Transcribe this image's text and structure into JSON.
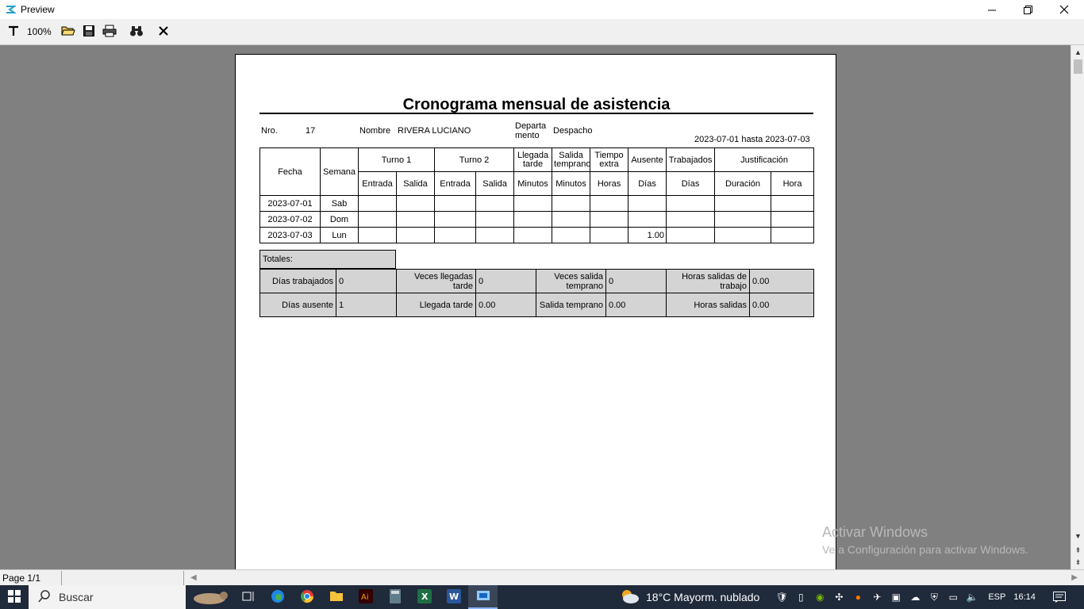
{
  "window": {
    "title": "Preview",
    "minimize": "—",
    "restore": "❐",
    "close": "✕"
  },
  "toolbar": {
    "zoom": "100%"
  },
  "report": {
    "title": "Cronograma mensual de asistencia",
    "nro_label": "Nro.",
    "nro_value": "17",
    "nombre_label": "Nombre",
    "nombre_value": "RIVERA LUCIANO",
    "depto_label_1": "Departa",
    "depto_label_2": "mento",
    "depto_value": "Despacho",
    "range": "2023-07-01 hasta 2023-07-03",
    "head1": {
      "fecha": "Fecha",
      "semana": "Semana",
      "turno1": "Turno 1",
      "turno2": "Turno 2",
      "llegada": "Llegada tarde",
      "salida_temp": "Salida temprano",
      "tiempo_extra": "Tiempo extra",
      "ausente": "Ausente",
      "trabajados": "Trabajados",
      "justificacion": "Justificación"
    },
    "head2": {
      "entrada1": "Entrada",
      "salida1": "Salida",
      "entrada2": "Entrada",
      "salida2": "Salida",
      "min1": "Minutos",
      "min2": "Minutos",
      "horas": "Horas",
      "dias1": "Días",
      "dias2": "Días",
      "duracion": "Duración",
      "hora": "Hora"
    },
    "rows": [
      {
        "fecha": "2023-07-01",
        "semana": "Sab",
        "ausente": ""
      },
      {
        "fecha": "2023-07-02",
        "semana": "Dom",
        "ausente": ""
      },
      {
        "fecha": "2023-07-03",
        "semana": "Lun",
        "ausente": "1.00"
      }
    ],
    "totals": {
      "label": "Totales:",
      "dias_trabajados_label": "Días trabajados",
      "dias_trabajados": "0",
      "veces_llegadas_label": "Veces llegadas tarde",
      "veces_llegadas": "0",
      "veces_salida_label": "Veces salida temprano",
      "veces_salida": "0",
      "horas_salidas_trabajo_label": "Horas salidas de trabajo",
      "horas_salidas_trabajo": "0.00",
      "dias_ausente_label": "Días ausente",
      "dias_ausente": "1",
      "llegada_tarde_label": "Llegada tarde",
      "llegada_tarde": "0.00",
      "salida_temprano_label": "Salida temprano",
      "salida_temprano": "0.00",
      "horas_salidas_label": "Horas salidas",
      "horas_salidas": "0.00"
    }
  },
  "watermark": {
    "line1": "Activar Windows",
    "line2": "Ve a Configuración para activar Windows."
  },
  "status": {
    "page": "Page 1/1"
  },
  "taskbar": {
    "search_placeholder": "Buscar",
    "weather": "18°C  Mayorm. nublado",
    "lang": "ESP",
    "time": "16:14"
  },
  "colors": {
    "viewport_bg": "#808080",
    "taskbar_bg": "#1f2a3a",
    "totals_bg": "#d4d4d4"
  }
}
